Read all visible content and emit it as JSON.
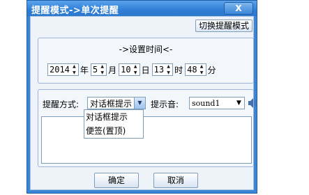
{
  "window": {
    "title": "提醒模式->单次提醒",
    "close_label": "X"
  },
  "toolbar": {
    "switch_mode_label": "切换提醒模式"
  },
  "time_section": {
    "title": "->设置时间<-",
    "year": "2014",
    "year_unit": "年",
    "month": "5",
    "month_unit": "月",
    "day": "10",
    "day_unit": "日",
    "hour": "13",
    "hour_unit": "时",
    "minute": "48",
    "minute_unit": "分"
  },
  "remind_section": {
    "method_label": "提醒方式:",
    "method_value": "对话框提示",
    "sound_label": "提示音:",
    "sound_value": "sound1",
    "message_text": ""
  },
  "method_dropdown": {
    "options": [
      "对话框提示",
      "便签(置顶)"
    ]
  },
  "buttons": {
    "ok_label": "确定",
    "cancel_label": "取消"
  },
  "icons": {
    "speaker": "speaker-icon",
    "close": "close-icon",
    "dropdown": "chevron-down-icon",
    "spin": "spin-arrows-icon"
  },
  "colors": {
    "titlebar": "#2f7fd6",
    "client_bg": "#eef3fa",
    "border": "#7f9db9"
  }
}
